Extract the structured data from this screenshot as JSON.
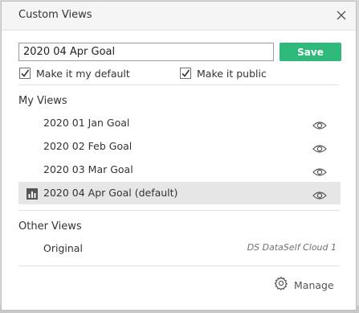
{
  "dialog": {
    "title": "Custom Views",
    "view_name_value": "2020 04 Apr Goal",
    "save_label": "Save",
    "make_default_label": "Make it my default",
    "make_default_checked": true,
    "make_public_label": "Make it public",
    "make_public_checked": true
  },
  "my_views": {
    "title": "My Views",
    "items": [
      {
        "label": "2020 01 Jan Goal",
        "icon": "eye-icon",
        "active": false
      },
      {
        "label": "2020 02 Feb Goal",
        "icon": "eye-icon",
        "active": false
      },
      {
        "label": "2020 03 Mar Goal",
        "icon": "eye-icon",
        "active": false
      },
      {
        "label": "2020 04 Apr Goal (default)",
        "icon": "eye-icon",
        "active": true,
        "leading_icon": "bar-chart-icon"
      }
    ]
  },
  "other_views": {
    "title": "Other Views",
    "items": [
      {
        "label": "Original",
        "source": "DS DataSelf Cloud 1"
      }
    ]
  },
  "manage": {
    "label": "Manage",
    "icon": "gear-icon"
  },
  "colors": {
    "accent": "#2fb97b",
    "active_row": "#e6e6e6",
    "titlebar": "#f5f5f5"
  }
}
